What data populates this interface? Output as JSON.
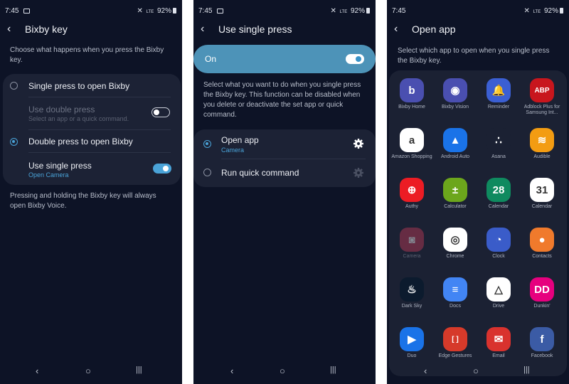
{
  "status": {
    "time": "7:45",
    "battery": "92%",
    "signal": "LTE"
  },
  "screen1": {
    "title": "Bixby key",
    "description": "Choose what happens when you press the Bixby key.",
    "options": [
      {
        "label": "Single press to open Bixby"
      },
      {
        "label": "Use double press",
        "sub": "Select an app or a quick command."
      },
      {
        "label": "Double press to open Bixby"
      },
      {
        "label": "Use single press",
        "sub": "Open Camera"
      }
    ],
    "footer": "Pressing and holding the Bixby key will always open Bixby Voice."
  },
  "screen2": {
    "title": "Use single press",
    "master_label": "On",
    "description": "Select what you want to do when you single press the Bixby key. This function can be disabled when you delete or deactivate the set app or quick command.",
    "options": [
      {
        "label": "Open app",
        "sub": "Camera"
      },
      {
        "label": "Run quick command"
      }
    ]
  },
  "screen3": {
    "title": "Open app",
    "description": "Select which app to open when you single press the Bixby key.",
    "apps": [
      {
        "name": "Bixby Home",
        "icon": "bixby-home-icon",
        "color": "#4a4fb0"
      },
      {
        "name": "Bixby Vision",
        "icon": "bixby-vision-icon",
        "color": "#4a4fb0"
      },
      {
        "name": "Reminder",
        "icon": "reminder-icon",
        "color": "#3b5fd3"
      },
      {
        "name": "Adblock Plus for Samsung Int...",
        "icon": "adblock-icon",
        "color": "#c8161d"
      },
      {
        "name": "Amazon Shopping",
        "icon": "amazon-icon",
        "color": "#ffffff"
      },
      {
        "name": "Android Auto",
        "icon": "android-auto-icon",
        "color": "#1a73e8"
      },
      {
        "name": "Asana",
        "icon": "asana-icon",
        "color": "#1b2133"
      },
      {
        "name": "Audible",
        "icon": "audible-icon",
        "color": "#f39c12"
      },
      {
        "name": "Authy",
        "icon": "authy-icon",
        "color": "#ec1c24"
      },
      {
        "name": "Calculator",
        "icon": "calculator-icon",
        "color": "#6ca61c"
      },
      {
        "name": "Calendar",
        "icon": "calendar-green-icon",
        "color": "#0f8a5f"
      },
      {
        "name": "Calendar",
        "icon": "calendar-blue-icon",
        "color": "#ffffff"
      },
      {
        "name": "Camera",
        "icon": "camera-icon",
        "color": "#c23a57"
      },
      {
        "name": "Chrome",
        "icon": "chrome-icon",
        "color": "#ffffff"
      },
      {
        "name": "Clock",
        "icon": "clock-icon",
        "color": "#3a5cc9"
      },
      {
        "name": "Contacts",
        "icon": "contacts-icon",
        "color": "#f07a2c"
      },
      {
        "name": "Dark Sky",
        "icon": "dark-sky-icon",
        "color": "#0c1b2e"
      },
      {
        "name": "Docs",
        "icon": "docs-icon",
        "color": "#4285f4"
      },
      {
        "name": "Drive",
        "icon": "drive-icon",
        "color": "#ffffff"
      },
      {
        "name": "Dunkin'",
        "icon": "dunkin-icon",
        "color": "#e6007e"
      },
      {
        "name": "Duo",
        "icon": "duo-icon",
        "color": "#1a73e8"
      },
      {
        "name": "Edge Gestures",
        "icon": "edge-gestures-icon",
        "color": "#d63a2a"
      },
      {
        "name": "Email",
        "icon": "email-icon",
        "color": "#d9322e"
      },
      {
        "name": "Facebook",
        "icon": "facebook-icon",
        "color": "#3b5ba5"
      }
    ]
  }
}
